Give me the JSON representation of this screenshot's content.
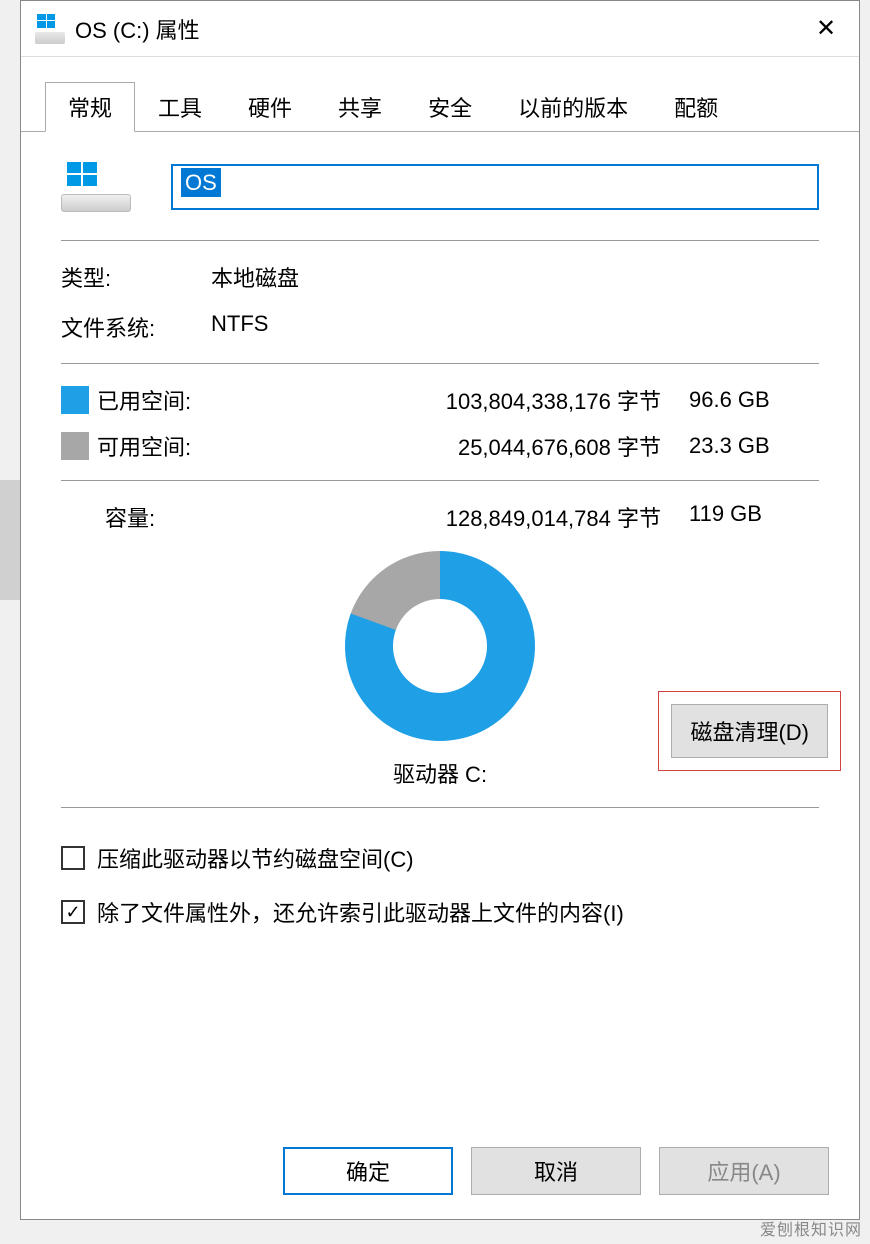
{
  "window": {
    "title": "OS (C:) 属性",
    "close_glyph": "✕"
  },
  "tabs": {
    "general": "常规",
    "tools": "工具",
    "hardware": "硬件",
    "sharing": "共享",
    "security": "安全",
    "previous": "以前的版本",
    "quota": "配额",
    "active": "general"
  },
  "drive": {
    "name_value": "OS"
  },
  "info": {
    "type_label": "类型:",
    "type_value": "本地磁盘",
    "fs_label": "文件系统:",
    "fs_value": "NTFS"
  },
  "space": {
    "used_label": "已用空间:",
    "used_bytes": "103,804,338,176 字节",
    "used_gb": "96.6 GB",
    "free_label": "可用空间:",
    "free_bytes": "25,044,676,608 字节",
    "free_gb": "23.3 GB",
    "capacity_label": "容量:",
    "capacity_bytes": "128,849,014,784 字节",
    "capacity_gb": "119 GB"
  },
  "chart": {
    "drive_label": "驱动器 C:"
  },
  "chart_data": {
    "type": "pie",
    "title": "驱动器 C:",
    "series": [
      {
        "name": "已用空间",
        "value_bytes": 103804338176,
        "value_gb": 96.6,
        "color": "#1e9fe6"
      },
      {
        "name": "可用空间",
        "value_bytes": 25044676608,
        "value_gb": 23.3,
        "color": "#a7a7a7"
      }
    ],
    "total_bytes": 128849014784,
    "total_gb": 119
  },
  "buttons": {
    "disk_cleanup": "磁盘清理(D)",
    "ok": "确定",
    "cancel": "取消",
    "apply": "应用(A)"
  },
  "options": {
    "compress": "压缩此驱动器以节约磁盘空间(C)",
    "compress_checked": false,
    "index": "除了文件属性外，还允许索引此驱动器上文件的内容(I)",
    "index_checked": true
  },
  "watermark": "爱刨根知识网"
}
